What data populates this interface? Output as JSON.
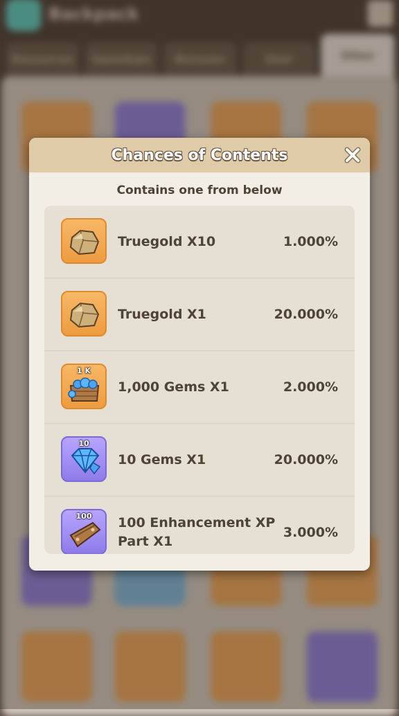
{
  "background": {
    "title": "Backpack",
    "tabs": [
      "Resources",
      "Speedups",
      "Bonuses",
      "Gear",
      "Other"
    ]
  },
  "modal": {
    "title": "Chances of Contents",
    "subtitle": "Contains one from below",
    "items": [
      {
        "name": "Truegold X10",
        "chance": "1.000%",
        "icon": "truegold-icon",
        "badge": "",
        "color": "orange"
      },
      {
        "name": "Truegold X1",
        "chance": "20.000%",
        "icon": "truegold-icon",
        "badge": "",
        "color": "orange"
      },
      {
        "name": "1,000 Gems X1",
        "chance": "2.000%",
        "icon": "gem-chest-icon",
        "badge": "1 K",
        "color": "orange"
      },
      {
        "name": "10 Gems X1",
        "chance": "20.000%",
        "icon": "gem-icon",
        "badge": "10",
        "color": "purple"
      },
      {
        "name": "100 Enhancement XP Part X1",
        "chance": "3.000%",
        "icon": "xp-part-icon",
        "badge": "100",
        "color": "purple"
      }
    ]
  },
  "colors": {
    "accent_orange": "#f2a94f",
    "accent_purple": "#a592f5",
    "header": "#e0cba8",
    "text": "#4f4336"
  }
}
